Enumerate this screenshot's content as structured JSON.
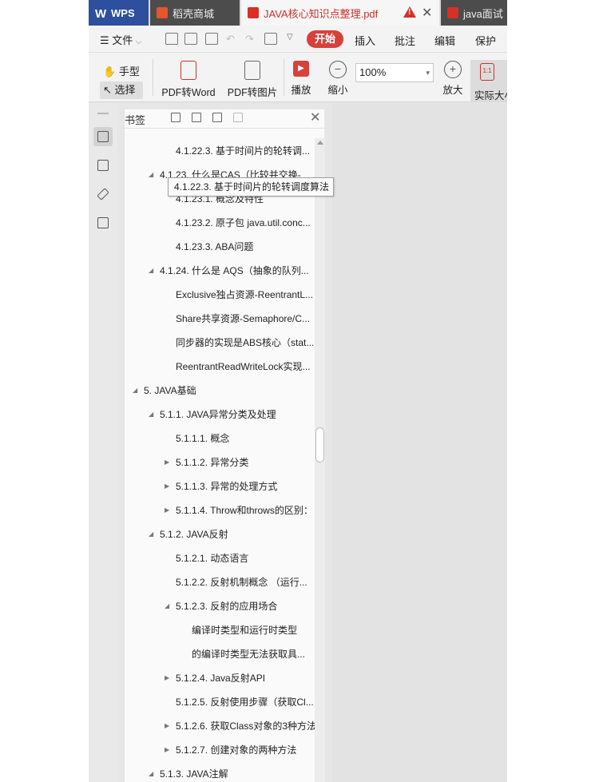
{
  "tabs": {
    "wps": "WPS",
    "daoke": "稻壳商城",
    "active_doc": "JAVA核心知识点整理.pdf",
    "other_doc": "java面试"
  },
  "menu": {
    "file": "文件",
    "start": "开始",
    "insert": "插入",
    "annotate": "批注",
    "edit": "编辑",
    "protect": "保护"
  },
  "toolbar": {
    "hand": "手型",
    "select": "选择",
    "pdf_to_word": "PDF转Word",
    "pdf_to_image": "PDF转图片",
    "play": "播放",
    "zoom_out": "缩小",
    "zoom_value": "100%",
    "zoom_in": "放大",
    "actual_size": "实际大小"
  },
  "panel": {
    "title": "书签"
  },
  "tooltip": "4.1.22.3. 基于时间片的轮转调度算法",
  "bookmarks": [
    {
      "text": "4.1.22.3. 基于时间片的轮转调...",
      "toggle": ""
    },
    {
      "text": "4.1.23. 什么是CAS（比较并交换-",
      "toggle": "◢"
    },
    {
      "text": "4.1.23.1. 概念及特性",
      "toggle": ""
    },
    {
      "text": "4.1.23.2. 原子包 java.util.conc...",
      "toggle": ""
    },
    {
      "text": "4.1.23.3. ABA问题",
      "toggle": ""
    },
    {
      "text": "4.1.24. 什么是 AQS（抽象的队列...",
      "toggle": "◢"
    },
    {
      "text": "Exclusive独占资源-ReentrantL...",
      "toggle": ""
    },
    {
      "text": "Share共享资源-Semaphore/C...",
      "toggle": ""
    },
    {
      "text": "同步器的实现是ABS核心（stat...",
      "toggle": ""
    },
    {
      "text": "ReentrantReadWriteLock实现...",
      "toggle": ""
    },
    {
      "text": "5. JAVA基础",
      "toggle": "◢"
    },
    {
      "text": "5.1.1. JAVA异常分类及处理",
      "toggle": "◢"
    },
    {
      "text": "5.1.1.1. 概念",
      "toggle": ""
    },
    {
      "text": "5.1.1.2. 异常分类",
      "toggle": "▶"
    },
    {
      "text": "5.1.1.3. 异常的处理方式",
      "toggle": "▶"
    },
    {
      "text": "5.1.1.4. Throw和throws的区别：",
      "toggle": "▶"
    },
    {
      "text": "5.1.2. JAVA反射",
      "toggle": "◢"
    },
    {
      "text": "5.1.2.1. 动态语言",
      "toggle": ""
    },
    {
      "text": "5.1.2.2. 反射机制概念 （运行...",
      "toggle": ""
    },
    {
      "text": "5.1.2.3. 反射的应用场合",
      "toggle": "◢"
    },
    {
      "text": "编译时类型和运行时类型",
      "toggle": ""
    },
    {
      "text": "的编译时类型无法获取具...",
      "toggle": ""
    },
    {
      "text": "5.1.2.4. Java反射API",
      "toggle": "▶"
    },
    {
      "text": "5.1.2.5. 反射使用步骤（获取Cl...",
      "toggle": ""
    },
    {
      "text": "5.1.2.6. 获取Class对象的3种方法",
      "toggle": "▶"
    },
    {
      "text": "5.1.2.7. 创建对象的两种方法",
      "toggle": "▶"
    },
    {
      "text": "5.1.3. JAVA注解",
      "toggle": "◢"
    }
  ]
}
